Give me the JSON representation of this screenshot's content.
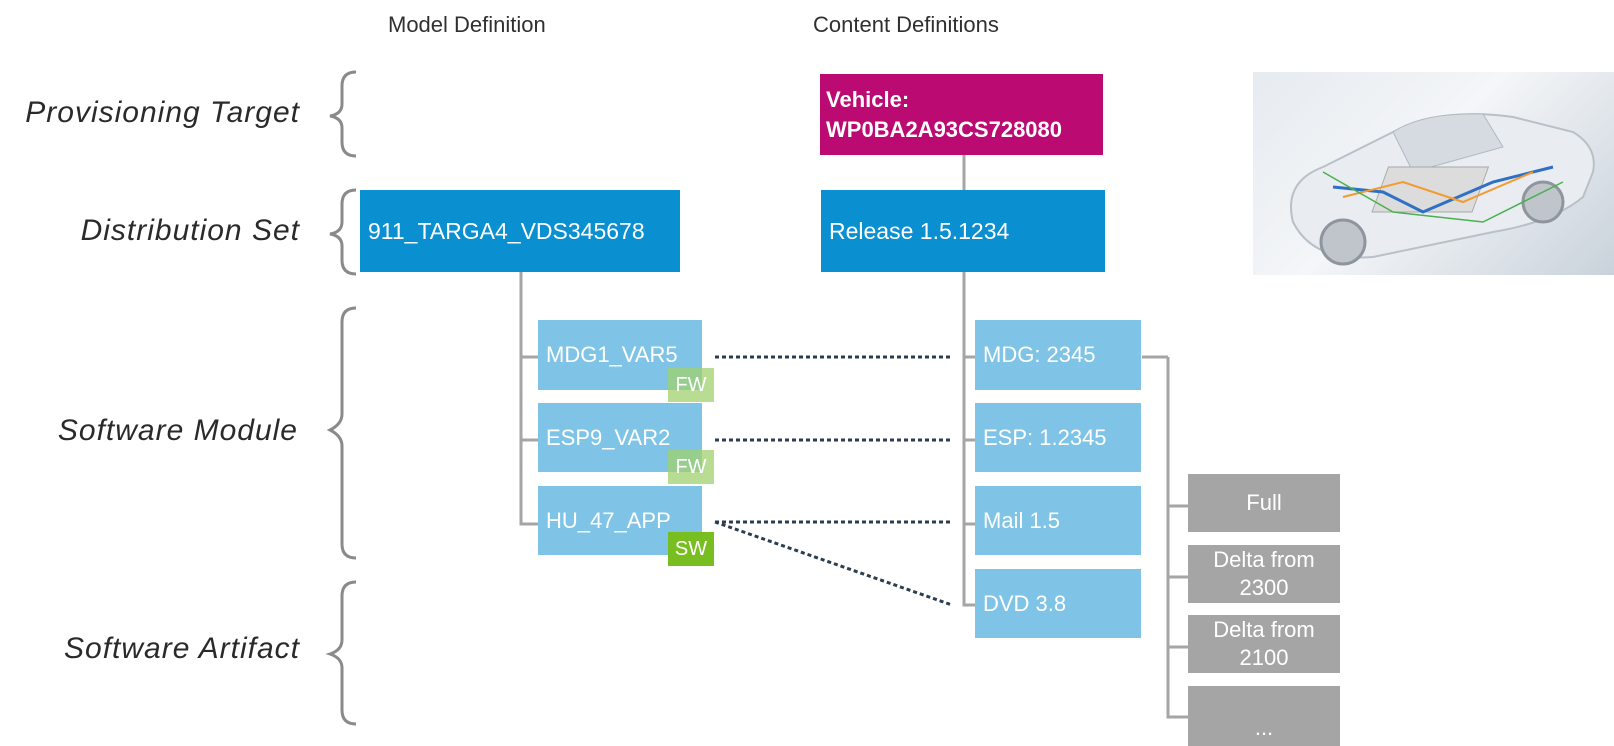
{
  "columns": {
    "model": "Model Definition",
    "content": "Content Definitions"
  },
  "row_labels": {
    "provisioning_target": "Provisioning Target",
    "distribution_set": "Distribution Set",
    "software_module": "Software Module",
    "software_artifact": "Software Artifact"
  },
  "model": {
    "distribution_set": "911_TARGA4_VDS345678",
    "modules": [
      {
        "name": "MDG1_VAR5",
        "tag": "FW"
      },
      {
        "name": "ESP9_VAR2",
        "tag": "FW"
      },
      {
        "name": "HU_47_APP",
        "tag": "SW"
      }
    ]
  },
  "content": {
    "target_line1": "Vehicle:",
    "target_line2": "WP0BA2A93CS728080",
    "release": "Release 1.5.1234",
    "modules": [
      "MDG: 2345",
      "ESP: 1.2345",
      "Mail 1.5",
      "DVD 3.8"
    ],
    "artifacts": [
      {
        "line1": "Full",
        "line2": ""
      },
      {
        "line1": "Delta from",
        "line2": "2300"
      },
      {
        "line1": "Delta from",
        "line2": "2100"
      },
      {
        "line1": "...",
        "line2": ""
      }
    ]
  },
  "image": {
    "semantic": "vehicle-cutaway-image"
  },
  "colors": {
    "distribution_set": "#0a8fd0",
    "target": "#bb0a71",
    "module": "#7fc4e6",
    "artifact": "#a5a5a5",
    "fw_tag": "#a0d26e",
    "sw_tag": "#78be20",
    "dotted_link": "#2b3e50"
  }
}
